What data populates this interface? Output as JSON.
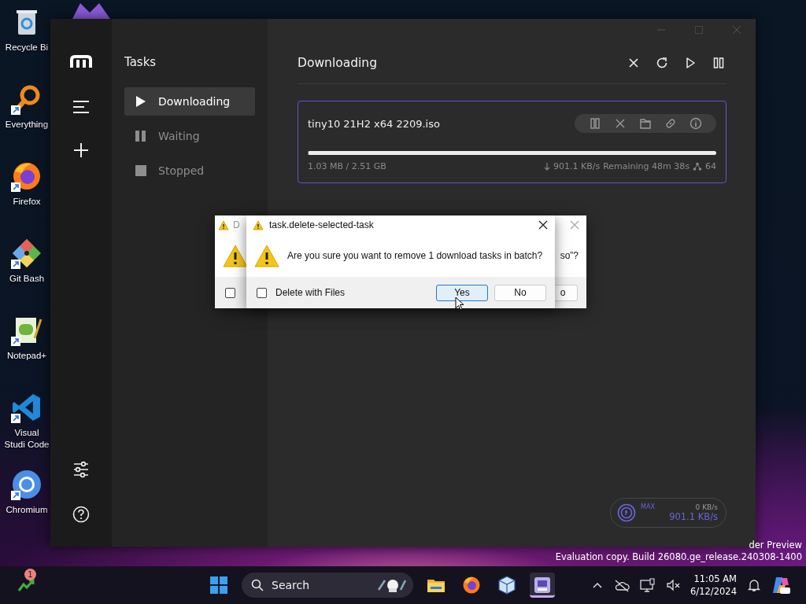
{
  "desktop_icons": [
    {
      "label": "Recycle Bi",
      "kind": "bin",
      "shortcut": false
    },
    {
      "label": "Everything",
      "kind": "magnifier",
      "shortcut": true
    },
    {
      "label": "Firefox",
      "kind": "browser",
      "shortcut": true
    },
    {
      "label": "Git Bash",
      "kind": "diamond",
      "shortcut": true
    },
    {
      "label": "Notepad+",
      "kind": "notepad",
      "shortcut": true
    },
    {
      "label": "Visual Studi Code",
      "kind": "editor",
      "shortcut": true
    },
    {
      "label": "Chromium",
      "kind": "chromium",
      "shortcut": true
    }
  ],
  "window": {
    "sidebar": {
      "title": "Tasks",
      "items": [
        {
          "label": "Downloading",
          "kind": "active",
          "selected": true
        },
        {
          "label": "Waiting",
          "kind": "waiting",
          "selected": false
        },
        {
          "label": "Stopped",
          "kind": "stopped",
          "selected": false
        }
      ]
    },
    "main": {
      "title": "Downloading",
      "tasks": [
        {
          "name": "tiny10 21H2 x64 2209.iso",
          "level": 0.0004,
          "size": "1.03 MB / 2.51 GB",
          "speed": "901.1 KB/s",
          "remaining": "Remaining 48m 38s",
          "connections": "64"
        }
      ],
      "speed_meter": {
        "label": "MAX",
        "upload": "0 KB/s",
        "download": "901.1 KB/s"
      }
    }
  },
  "back_dialog": {
    "title": "D",
    "message": "so”?",
    "checkbox": {
      "checked": false
    },
    "button": "o"
  },
  "dialog": {
    "title": "task.delete-selected-task",
    "message": "Are you sure you want to remove 1 download tasks in batch?",
    "checkbox": {
      "label": "Delete with Files",
      "checked": false
    },
    "buttons": [
      {
        "label": "Yes",
        "default": true
      },
      {
        "label": "No",
        "default": false
      }
    ]
  },
  "watermark": [
    "der Preview",
    "Evaluation copy. Build 26080.ge_release.240308-1400"
  ],
  "taskbar": {
    "widget_badge": "1",
    "search": {
      "placeholder": "Search"
    },
    "apps": [
      {
        "kind": "folder",
        "active": false
      },
      {
        "kind": "browser",
        "active": false
      },
      {
        "kind": "cube",
        "active": false
      },
      {
        "kind": "downloader",
        "active": true
      }
    ],
    "time": "11:05 AM",
    "date": "6/12/2024"
  }
}
